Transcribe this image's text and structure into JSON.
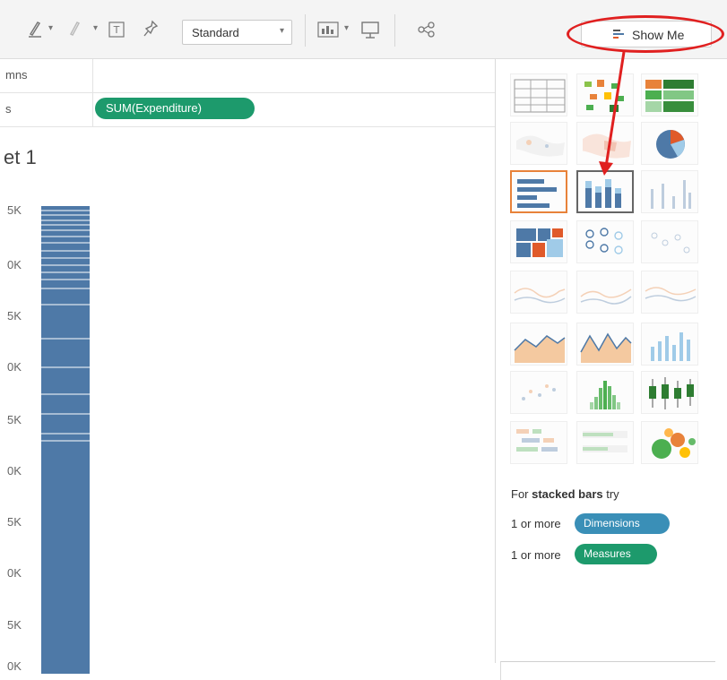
{
  "toolbar": {
    "mark_size_select": "Standard",
    "show_me_label": "Show Me"
  },
  "shelves": {
    "columns_label": "mns",
    "rows_label": "s",
    "rows_pill": "SUM(Expenditure)"
  },
  "sheet": {
    "title": "et 1",
    "y_ticks": [
      "5K",
      "0K",
      "5K",
      "0K",
      "5K",
      "0K",
      "5K",
      "0K",
      "5K",
      "0K"
    ]
  },
  "chart_data": {
    "type": "bar",
    "categories": [
      ""
    ],
    "series": [
      {
        "values": [
          1
        ]
      }
    ],
    "title": "",
    "xlabel": "",
    "ylabel": ""
  },
  "show_me": {
    "hint_prefix": "For ",
    "hint_bold": "stacked bars",
    "hint_suffix": " try",
    "req_1_prefix": "1 or more",
    "req_1_pill": "Dimensions",
    "req_2_prefix": "1 or more",
    "req_2_pill": "Measures",
    "chart_types": [
      "text-table",
      "highlight-table",
      "heat-map",
      "symbol-map",
      "filled-map",
      "pie-chart",
      "horizontal-bars",
      "stacked-bars",
      "side-by-side-bars",
      "treemap",
      "circle-views",
      "side-by-side-circles",
      "continuous-lines",
      "discrete-lines",
      "dual-lines",
      "area-continuous",
      "area-discrete",
      "dual-combination",
      "scatter-plot",
      "histogram",
      "box-and-whisker",
      "gantt-chart",
      "bullet-graph",
      "packed-bubbles"
    ]
  },
  "colors": {
    "bar": "#4e79a7",
    "measure_pill": "#1d9a6c",
    "dimension_pill": "#3a8fb7",
    "highlight_circle": "#e02020",
    "selected_orange": "#e8823a"
  }
}
